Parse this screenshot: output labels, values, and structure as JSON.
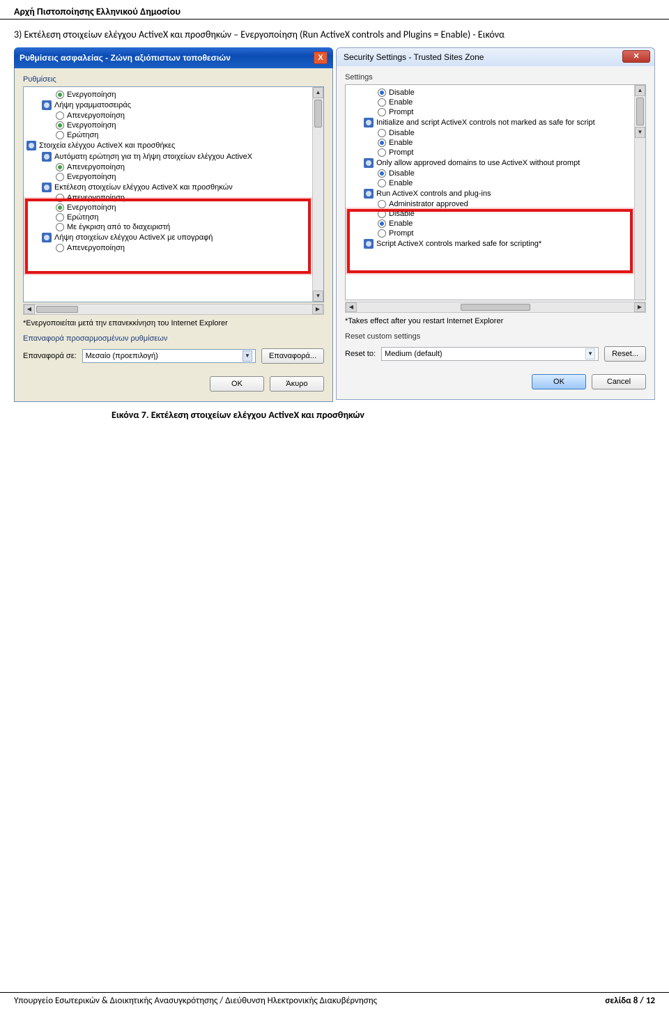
{
  "doc": {
    "header": "Αρχή Πιστοποίησης Ελληνικού Δημοσίου",
    "instruction": "3) Εκτέλεση στοιχείων ελέγχου ActiveX και προσθηκών – Ενεργοποίηση (Run ActiveX controls and Plugins = Enable) - Εικόνα",
    "caption": "Εικόνα 7. Εκτέλεση στοιχείων ελέγχου ActiveX και προσθηκών",
    "footer_left": "Υπουργείο Εσωτερικών & Διοικητικής Ανασυγκρότησης / Διεύθυνση Ηλεκτρονικής Διακυβέρνησης",
    "footer_right": "σελίδα 8 / 12"
  },
  "left": {
    "title": "Ρυθμίσεις ασφαλείας - Ζώνη αξιόπιστων τοποθεσιών",
    "group": "Ρυθμίσεις",
    "items": {
      "a": "Ενεργοποίηση",
      "b": "Λήψη γραμματοσειράς",
      "c": "Απενεργοποίηση",
      "d": "Ενεργοποίηση",
      "e": "Ερώτηση",
      "f": "Στοιχεία ελέγχου ActiveX και προσθήκες",
      "g": "Αυτόματη ερώτηση για τη λήψη στοιχείων ελέγχου ActiveX",
      "h": "Απενεργοποίηση",
      "i": "Ενεργοποίηση",
      "j": "Εκτέλεση στοιχείων ελέγχου ActiveX και προσθηκών",
      "k": "Απενεργοποίηση",
      "l": "Ενεργοποίηση",
      "m": "Ερώτηση",
      "n": "Με έγκριση από το διαχειριστή",
      "o": "Λήψη στοιχείων ελέγχου ActiveX με υπογραφή",
      "p": "Απενεργοποίηση"
    },
    "note": "*Ενεργοποιείται μετά την επανεκκίνηση του Internet Explorer",
    "reset_group": "Επαναφορά προσαρμοσμένων ρυθμίσεων",
    "reset_to": "Επαναφορά σε:",
    "combo": "Μεσαίο (προεπιλογή)",
    "reset_btn": "Επαναφορά...",
    "ok": "OK",
    "cancel": "Άκυρο"
  },
  "right": {
    "title": "Security Settings - Trusted Sites Zone",
    "group": "Settings",
    "items": {
      "a": "Disable",
      "b": "Enable",
      "c": "Prompt",
      "d": "Initialize and script ActiveX controls not marked as safe for script",
      "e": "Disable",
      "f": "Enable",
      "g": "Prompt",
      "h": "Only allow approved domains to use ActiveX without prompt",
      "i": "Disable",
      "j": "Enable",
      "k": "Run ActiveX controls and plug-ins",
      "l": "Administrator approved",
      "m": "Disable",
      "n": "Enable",
      "o": "Prompt",
      "p": "Script ActiveX controls marked safe for scripting*"
    },
    "note": "*Takes effect after you restart Internet Explorer",
    "reset_group": "Reset custom settings",
    "reset_to": "Reset to:",
    "combo": "Medium (default)",
    "reset_btn": "Reset...",
    "ok": "OK",
    "cancel": "Cancel"
  }
}
